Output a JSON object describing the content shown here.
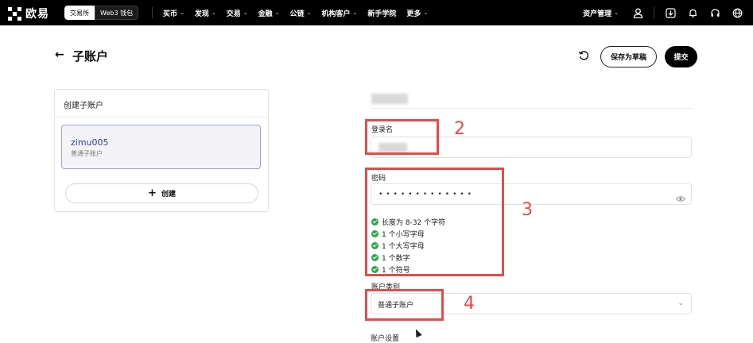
{
  "topbar": {
    "logo_text": "欧易",
    "segments": [
      "交易所",
      "Web3 钱包"
    ],
    "nav": [
      "买币",
      "发现",
      "交易",
      "金融",
      "公链",
      "机构客户",
      "新手学院",
      "更多"
    ],
    "nav_has_chevron": [
      true,
      true,
      true,
      true,
      true,
      true,
      false,
      true
    ],
    "asset_label": "资产管理"
  },
  "header": {
    "back_arrow": "←",
    "title": "子账户",
    "draft_button": "保存为草稿",
    "submit_button": "提交"
  },
  "sidebar": {
    "card_title": "创建子账户",
    "item_name": "zimu005",
    "item_type": "普通子账户",
    "create_label": "创建",
    "create_icon": "+"
  },
  "form": {
    "login_label": "登录名",
    "password_label": "密码",
    "password_mask": "•••••••••••••",
    "rules": [
      "长度为 8-32 个字符",
      "1 个小写字母",
      "1 个大写字母",
      "1 个数字",
      "1 个符号"
    ],
    "account_type_label": "账户类别",
    "account_type_value": "普通子账户",
    "next_label_partial": "账户设置"
  },
  "annotations": {
    "numbers": [
      "2",
      "3",
      "4"
    ],
    "color": "#e34b4b"
  },
  "colors": {
    "check_green": "#2ea84a",
    "selected_border": "#9aa3d9",
    "selected_text": "#2b3c8c"
  }
}
